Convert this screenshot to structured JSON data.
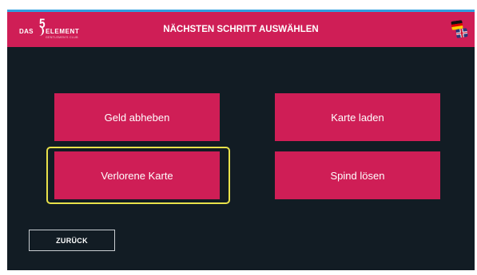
{
  "header": {
    "title": "NÄCHSTEN SCHRITT AUSWÄHLEN",
    "logo": {
      "mark": "5",
      "prefix": "DAS",
      "name": "ELEMENT",
      "tagline": "GENTLEMEN'S CLUB"
    },
    "language_icon": "flag-de-gb-icon"
  },
  "actions": [
    {
      "label": "Geld abheben"
    },
    {
      "label": "Karte laden"
    },
    {
      "label": "Verlorene Karte",
      "focused": true
    },
    {
      "label": "Spind lösen"
    }
  ],
  "back_label": "ZURÜCK",
  "colors": {
    "accent": "#cf1e56",
    "background": "#121c24",
    "focus": "#e8e14a",
    "header_top_border": "#2f9fe0"
  }
}
